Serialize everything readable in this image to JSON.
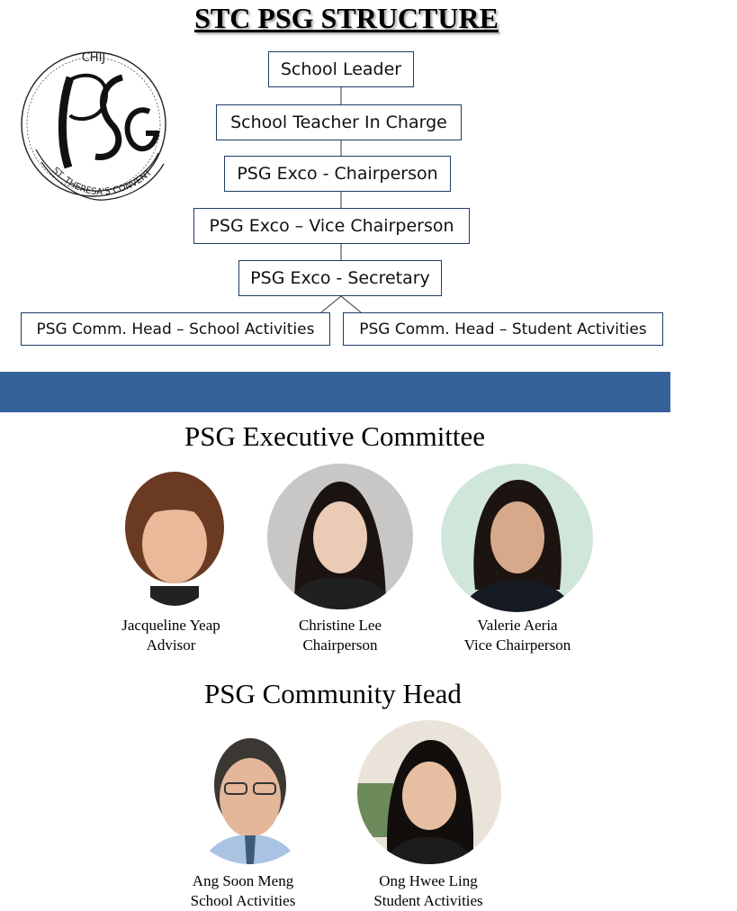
{
  "title": "STC PSG STRUCTURE",
  "logo": {
    "top_text": "CHIJ",
    "monogram": "PSG",
    "ribbon_text": "ST. THERESA'S CONVENT"
  },
  "org_chart": {
    "nodes": [
      "School Leader",
      "School Teacher In Charge",
      "PSG Exco - Chairperson",
      "PSG Exco – Vice Chairperson",
      "PSG Exco - Secretary",
      "PSG Comm. Head – School Activities",
      "PSG Comm. Head – Student Activities"
    ]
  },
  "colors": {
    "band": "#36629a",
    "box_border": "#1f3c66"
  },
  "executive": {
    "heading": "PSG Executive Committee",
    "members": [
      {
        "name": "Jacqueline Yeap",
        "role": "Advisor"
      },
      {
        "name": "Christine Lee",
        "role": "Chairperson"
      },
      {
        "name": "Valerie Aeria",
        "role": "Vice Chairperson"
      }
    ]
  },
  "community": {
    "heading": "PSG Community Head",
    "members": [
      {
        "name": "Ang Soon Meng",
        "role": "School Activities"
      },
      {
        "name": "Ong Hwee Ling",
        "role": "Student Activities"
      }
    ]
  }
}
